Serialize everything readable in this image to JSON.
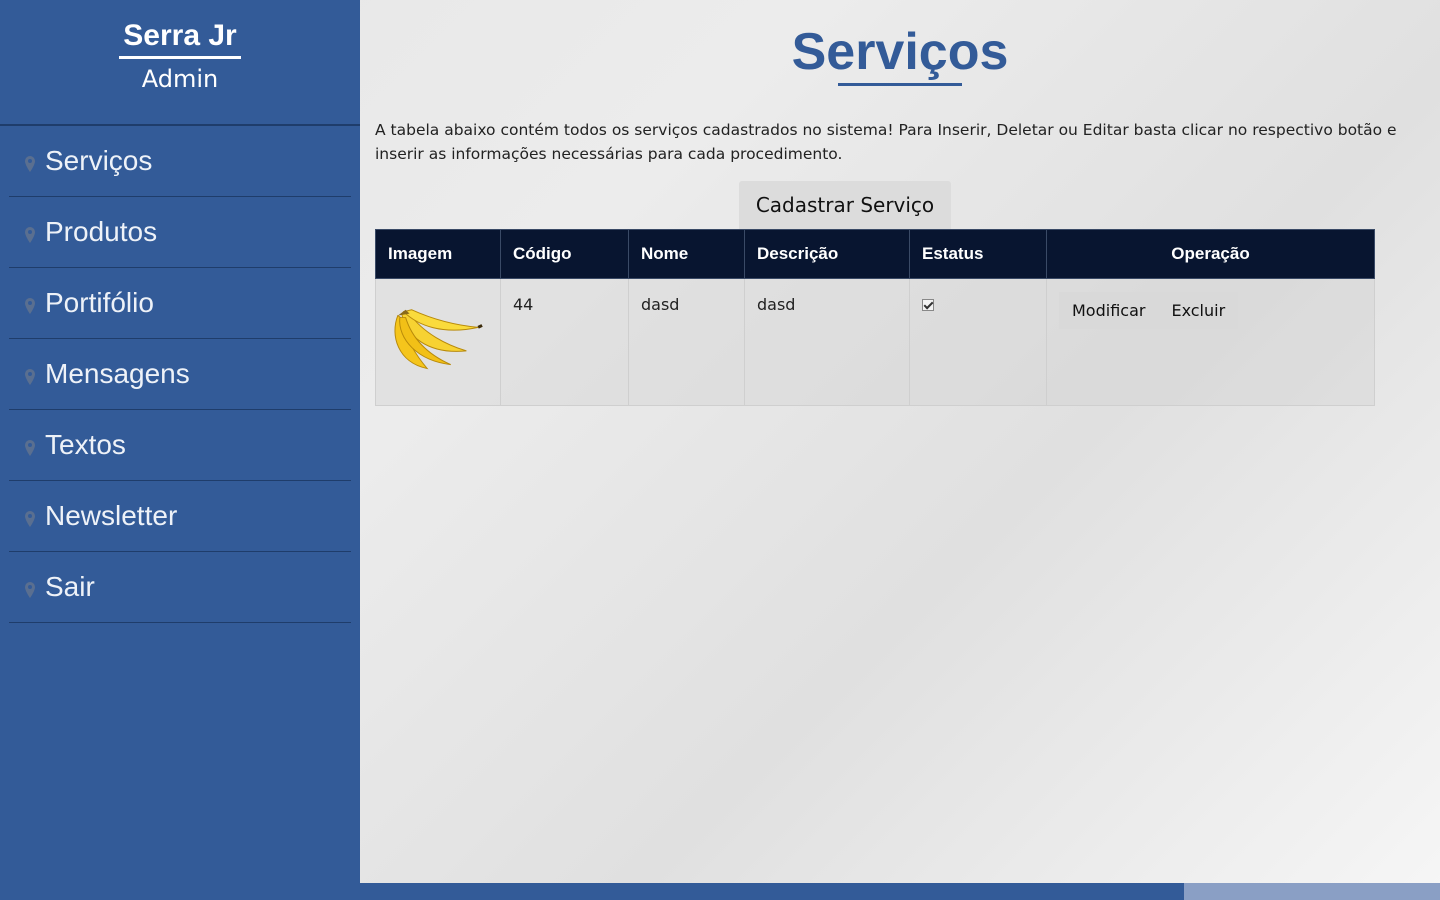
{
  "sidebar": {
    "brand": "Serra Jr",
    "subtitle": "Admin",
    "items": [
      {
        "label": "Serviços",
        "icon": "map-pin-icon"
      },
      {
        "label": "Produtos",
        "icon": "map-pin-icon"
      },
      {
        "label": "Portifólio",
        "icon": "map-pin-icon"
      },
      {
        "label": "Mensagens",
        "icon": "map-pin-icon"
      },
      {
        "label": "Textos",
        "icon": "map-pin-icon"
      },
      {
        "label": "Newsletter",
        "icon": "map-pin-icon"
      },
      {
        "label": "Sair",
        "icon": "map-pin-icon"
      }
    ]
  },
  "main": {
    "title": "Serviços",
    "intro": "A tabela abaixo contém todos os serviços cadastrados no sistema! Para Inserir, Deletar ou Editar basta clicar no respectivo botão e inserir as informações necessárias para cada procedimento.",
    "add_button": "Cadastrar Serviço",
    "table": {
      "headers": [
        "Imagem",
        "Código",
        "Nome",
        "Descrição",
        "Estatus",
        "Operação"
      ],
      "rows": [
        {
          "image": "banana-image",
          "codigo": "44",
          "nome": "dasd",
          "descricao": "dasd",
          "estatus": true,
          "modify": "Modificar",
          "delete": "Excluir"
        }
      ]
    }
  },
  "colors": {
    "sidebar": "#335b98",
    "table_header": "#081530",
    "accent": "#335b98"
  }
}
